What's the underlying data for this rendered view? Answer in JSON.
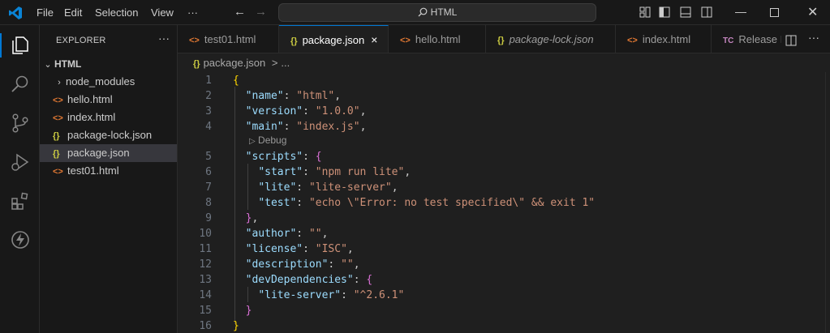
{
  "menu": [
    "File",
    "Edit",
    "Selection",
    "View"
  ],
  "menu_more": "···",
  "search": {
    "text": "HTML"
  },
  "explorer": {
    "title": "EXPLORER",
    "more": "···",
    "root": "HTML",
    "items": [
      {
        "label": "node_modules",
        "icon": "chevron-right-icon",
        "type": "folder"
      },
      {
        "label": "hello.html",
        "icon": "html-file-icon",
        "type": "html"
      },
      {
        "label": "index.html",
        "icon": "html-file-icon",
        "type": "html"
      },
      {
        "label": "package-lock.json",
        "icon": "json-file-icon",
        "type": "json"
      },
      {
        "label": "package.json",
        "icon": "json-file-icon",
        "type": "json",
        "selected": true
      },
      {
        "label": "test01.html",
        "icon": "html-file-icon",
        "type": "html"
      }
    ]
  },
  "tabs": [
    {
      "label": "test01.html",
      "icon": "<>"
    },
    {
      "label": "package.json",
      "icon": "{}",
      "active": true,
      "close": "×"
    },
    {
      "label": "hello.html",
      "icon": "<>"
    },
    {
      "label": "package-lock.json",
      "icon": "{}",
      "italic": true
    },
    {
      "label": "index.html",
      "icon": "<>"
    },
    {
      "label": "Release I",
      "icon": "TC"
    }
  ],
  "breadcrumb": {
    "file": "package.json",
    "separator": ">",
    "rest": "..."
  },
  "codelens": "Debug",
  "code": {
    "line_numbers": [
      "1",
      "2",
      "3",
      "4",
      "5",
      "6",
      "7",
      "8",
      "9",
      "10",
      "11",
      "12",
      "13",
      "14",
      "15",
      "16"
    ],
    "lines": [
      "{",
      "  \"name\": \"html\",",
      "  \"version\": \"1.0.0\",",
      "  \"main\": \"index.js\",",
      "  \"scripts\": {",
      "    \"start\": \"npm run lite\",",
      "    \"lite\": \"lite-server\",",
      "    \"test\": \"echo \\\"Error: no test specified\\\" && exit 1\"",
      "  },",
      "  \"author\": \"\",",
      "  \"license\": \"ISC\",",
      "  \"description\": \"\",",
      "  \"devDependencies\": {",
      "    \"lite-server\": \"^2.6.1\"",
      "  }",
      "}"
    ]
  },
  "colors": {
    "accent": "#0078d4",
    "json_key": "#9cdcfe",
    "json_string": "#ce9178",
    "bracket_level1": "#ffd700",
    "bracket_level2": "#da70d6",
    "html_icon": "#e37933",
    "json_icon": "#cbcb41"
  }
}
